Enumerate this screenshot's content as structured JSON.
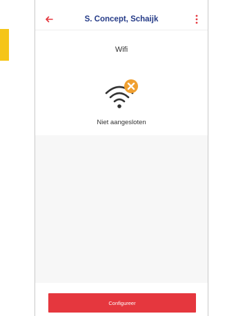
{
  "header": {
    "title": "S. Concept, Schaijk",
    "back_icon": "arrow-left-icon",
    "menu_icon": "more-vertical-icon"
  },
  "page": {
    "title": "Wifi",
    "status": "Niet aangesloten",
    "status_icon": "wifi-disconnected-icon"
  },
  "actions": {
    "configure_label": "Configureer"
  },
  "colors": {
    "accent_red": "#e5373e",
    "title_blue": "#243a87",
    "warning_orange": "#f0a030",
    "side_tab_yellow": "#f5c518"
  }
}
